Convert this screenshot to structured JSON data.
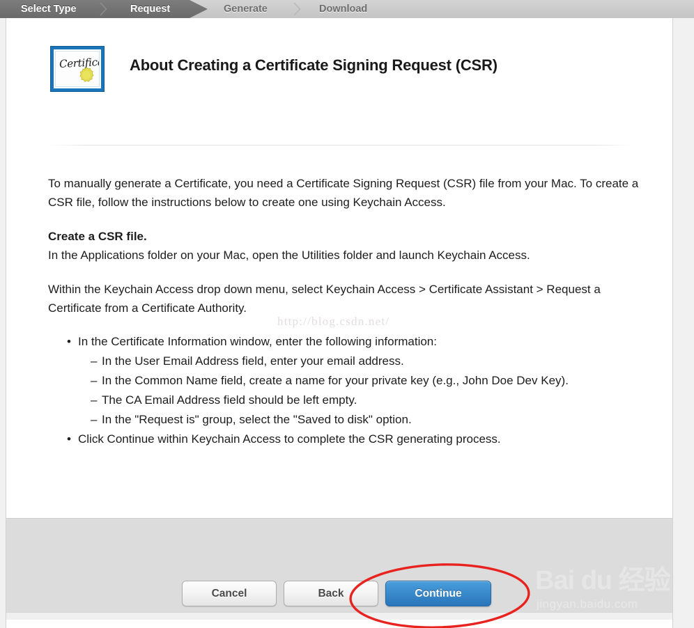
{
  "wizard": {
    "steps": [
      {
        "label": "Select Type",
        "state": "completed"
      },
      {
        "label": "Request",
        "state": "active"
      },
      {
        "label": "Generate",
        "state": "upcoming"
      },
      {
        "label": "Download",
        "state": "upcoming"
      }
    ]
  },
  "header": {
    "icon_label": "certificate-icon",
    "icon_word": "Certificate",
    "title": "About Creating a Certificate Signing Request (CSR)"
  },
  "body": {
    "intro": "To manually generate a Certificate, you need a Certificate Signing Request (CSR) file from your Mac. To create a CSR file, follow the instructions below to create one using Keychain Access.",
    "subheading": "Create a CSR file.",
    "subheading_body": "In the Applications folder on your Mac, open the Utilities folder and launch Keychain Access.",
    "menu_path": "Within the Keychain Access drop down menu, select Keychain Access > Certificate Assistant > Request a Certificate from a Certificate Authority.",
    "bullet_glyph": "•",
    "dash_glyph": "–",
    "items": [
      {
        "text": "In the Certificate Information window, enter the following information:",
        "children": [
          "In the User Email Address field, enter your email address.",
          "In the Common Name field, create a name for your private key (e.g., John Doe Dev Key).",
          "The CA Email Address field should be left empty.",
          "In the \"Request is\" group, select the \"Saved to disk\" option."
        ]
      },
      {
        "text": "Click Continue within Keychain Access to complete the CSR generating process.",
        "children": []
      }
    ]
  },
  "footer": {
    "cancel_label": "Cancel",
    "back_label": "Back",
    "continue_label": "Continue"
  },
  "annotation": {
    "shape": "red-ellipse-highlight",
    "target": "continue-button",
    "color": "#e8231f"
  },
  "watermarks": {
    "csdn": "http://blog.csdn.net/",
    "baidu_main": "Bai du 经验",
    "baidu_sub": "jingyan.baidu.com"
  },
  "colors": {
    "step_active_bg": "#6f6f6f",
    "step_inactive_bg": "#c9c9c9",
    "primary_button": "#3a8ccd",
    "panel_bg": "#ffffff",
    "footer_bg": "#dcdcdc",
    "icon_border": "#1b75bb",
    "seal": "#e2da52"
  }
}
